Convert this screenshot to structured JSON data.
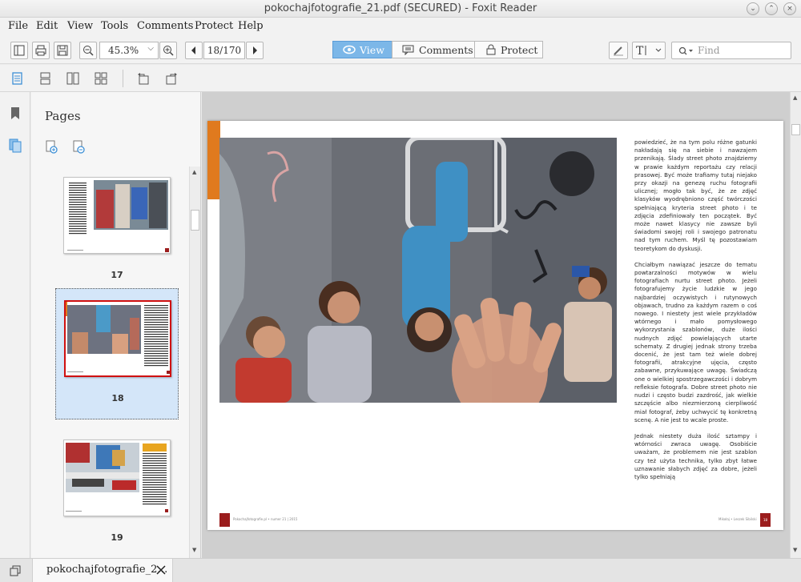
{
  "window": {
    "title": "pokochajfotografie_21.pdf (SECURED) - Foxit Reader"
  },
  "menu": [
    "File",
    "Edit",
    "View",
    "Tools",
    "Comments",
    "Protect",
    "Help"
  ],
  "toolbar": {
    "zoom": "45.3%",
    "page_indicator": "18/170",
    "modes": [
      {
        "label": "View",
        "active": true
      },
      {
        "label": "Comments",
        "active": false
      },
      {
        "label": "Protect",
        "active": false
      }
    ],
    "find_placeholder": "Find"
  },
  "pages_panel": {
    "title": "Pages",
    "thumbnails": [
      {
        "number": "17",
        "selected": false
      },
      {
        "number": "18",
        "selected": true
      },
      {
        "number": "19",
        "selected": false
      }
    ]
  },
  "document": {
    "paragraphs": [
      "powiedzieć, że na tym polu różne gatunki nakładają się na siebie i nawzajem przenikają. Ślady street photo znajdziemy w prawie każdym reportażu czy relacji prasowej. Być może trafiamy tutaj niejako przy okazji na genezę ruchu fotografii ulicznej; mogło tak być, że ze zdjęć klasyków wyodrębniono część twórczości spełniającą kryteria street photo i te zdjęcia zdefiniowały ten początek. Być może nawet klasycy nie zawsze byli świadomi swojej roli i swojego patronatu nad tym ruchem. Myśl tę pozostawiam teoretykom do dyskusji.",
      "Chciałbym nawiązać jeszcze do tematu powtarzalności motywów w wielu fotografiach nurtu street photo. Jeżeli fotografujemy życie ludzkie w jego najbardziej oczywistych i rutynowych objawach, trudno za każdym razem o coś nowego. I niestety jest wiele przykładów wtórnego i mało pomysłowego wykorzystania szablonów, duże ilości nudnych zdjęć powielających utarte schematy. Z drugiej jednak strony trzeba docenić, że jest tam też wiele dobrej fotografii, atrakcyjne ujęcia, często zabawne, przykuwające uwagę. Świadczą one o wielkiej spostrzegawczości i dobrym refleksie fotografa. Dobre street photo nie nudzi i często budzi zazdrość, jak wielkie szczęście albo niezmierzoną cierpliwość miał fotograf, żeby uchwycić tę konkretną scenę. A nie jest to wcale proste.",
      "Jednak niestety duża ilość sztampy i wtórności zwraca uwagę. Osobiście uważam, że problemem nie jest szablon czy też użyta technika, tylko zbyt łatwe uznawanie słabych zdjęć za dobre, jeżeli tylko spełniają"
    ],
    "footer_left": "Pokochajfotografie.pl • numer 21 | 2015",
    "footer_author": "Mikołaj • Leszek Sibilski",
    "footer_page": "18"
  },
  "tabs": [
    {
      "label": "pokochajfotografie_2…"
    }
  ],
  "colors": {
    "accent": "#7cb7e8",
    "thumb_selected_bg": "#d4e6f9",
    "thumb_selected_border": "#d01010",
    "orange_bar": "#e07a1e",
    "footer_red": "#9b1d1d"
  }
}
